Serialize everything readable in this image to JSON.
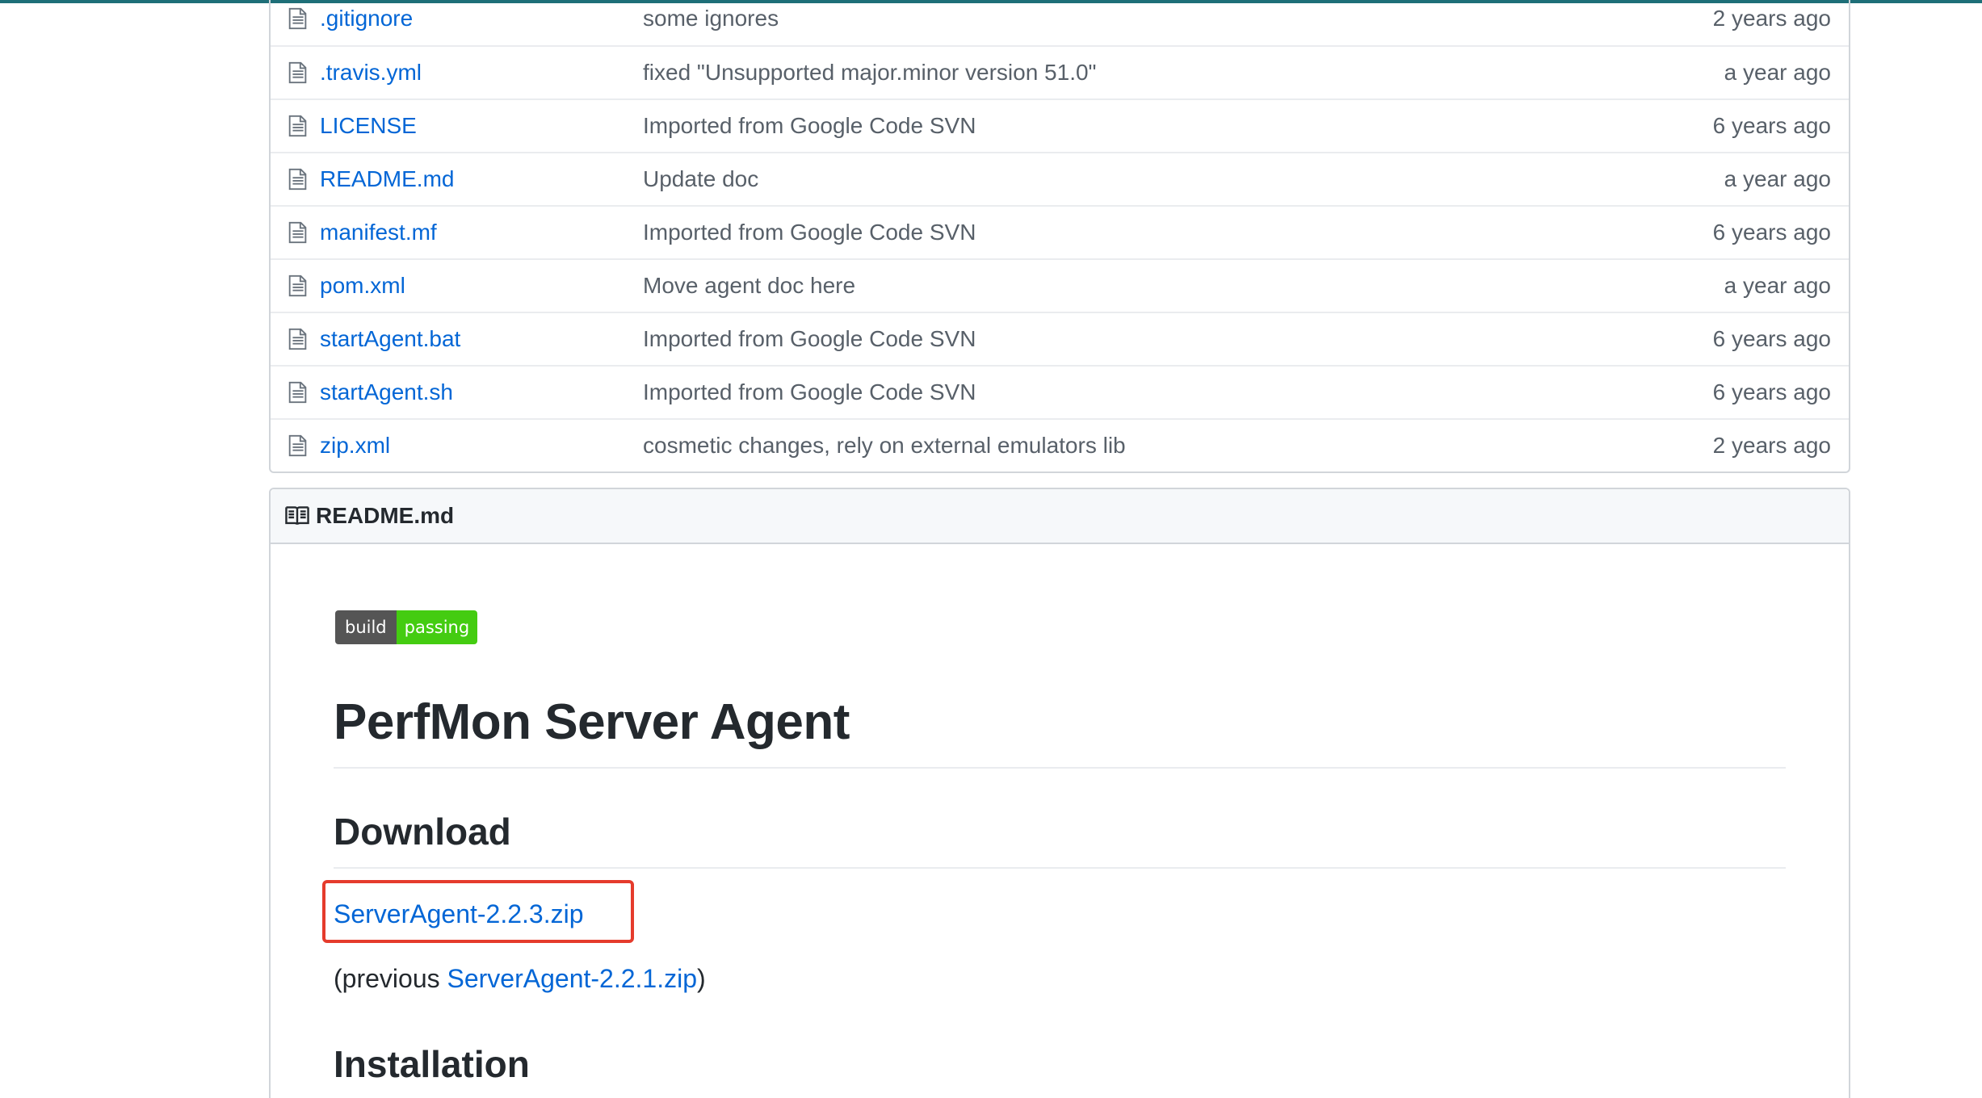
{
  "files": [
    {
      "name": ".gitignore",
      "message": "some ignores",
      "age": "2 years ago"
    },
    {
      "name": ".travis.yml",
      "message": "fixed \"Unsupported major.minor version 51.0\"",
      "age": "a year ago"
    },
    {
      "name": "LICENSE",
      "message": "Imported from Google Code SVN",
      "age": "6 years ago"
    },
    {
      "name": "README.md",
      "message": "Update doc",
      "age": "a year ago"
    },
    {
      "name": "manifest.mf",
      "message": "Imported from Google Code SVN",
      "age": "6 years ago"
    },
    {
      "name": "pom.xml",
      "message": "Move agent doc here",
      "age": "a year ago"
    },
    {
      "name": "startAgent.bat",
      "message": "Imported from Google Code SVN",
      "age": "6 years ago"
    },
    {
      "name": "startAgent.sh",
      "message": "Imported from Google Code SVN",
      "age": "6 years ago"
    },
    {
      "name": "zip.xml",
      "message": "cosmetic changes, rely on external emulators lib",
      "age": "2 years ago"
    }
  ],
  "readme": {
    "header": "README.md",
    "badge": {
      "left": "build",
      "right": "passing"
    },
    "title": "PerfMon Server Agent",
    "download_heading": "Download",
    "download_link": "ServerAgent-2.2.3.zip",
    "previous_prefix": "(previous ",
    "previous_link": "ServerAgent-2.2.1.zip",
    "previous_suffix": ")",
    "installation_heading": "Installation"
  },
  "colors": {
    "link": "#0366d6",
    "callout": "#e53b2c",
    "badge_pass": "#44cc11"
  },
  "icons": [
    "file-icon",
    "book-icon"
  ]
}
